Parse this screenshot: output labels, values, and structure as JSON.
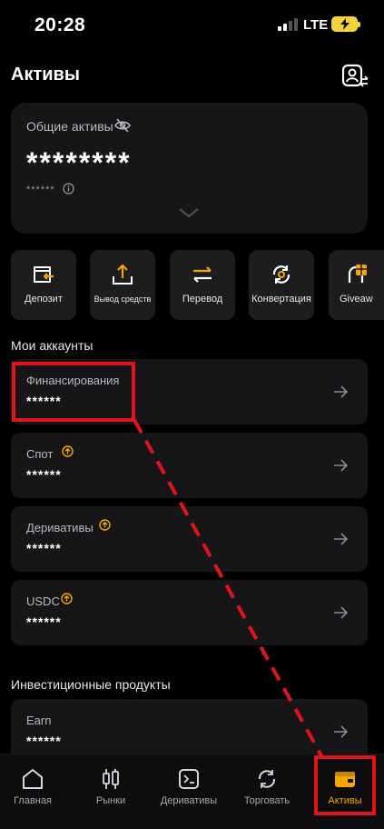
{
  "status": {
    "time": "20:28",
    "network": "LTE"
  },
  "header": {
    "title": "Активы"
  },
  "total": {
    "label": "Общие активы",
    "value": "********",
    "sub": "******"
  },
  "actions": [
    {
      "label": "Депозит",
      "icon": "deposit-icon"
    },
    {
      "label": "Вывод средств",
      "icon": "withdraw-icon"
    },
    {
      "label": "Перевод",
      "icon": "transfer-icon"
    },
    {
      "label": "Конвертация",
      "icon": "convert-icon"
    },
    {
      "label": "Giveaw",
      "icon": "giveaway-icon"
    }
  ],
  "accounts": {
    "title": "Мои аккаунты",
    "items": [
      {
        "name": "Финансирования",
        "value": "******"
      },
      {
        "name": "Спот",
        "value": "******"
      },
      {
        "name": "Деривативы",
        "value": "******"
      },
      {
        "name": "USDC",
        "value": "******"
      }
    ]
  },
  "investments": {
    "title": "Инвестиционные продукты",
    "items": [
      {
        "name": "Earn",
        "value": "******"
      }
    ]
  },
  "nav": [
    {
      "label": "Главная",
      "icon": "home-icon"
    },
    {
      "label": "Рынки",
      "icon": "markets-icon"
    },
    {
      "label": "Деривативы",
      "icon": "derivatives-icon"
    },
    {
      "label": "Торговать",
      "icon": "trade-icon"
    },
    {
      "label": "Активы",
      "icon": "wallet-icon"
    }
  ],
  "colors": {
    "accent": "#f7a600",
    "annotation": "#e0141b",
    "card": "#161618"
  }
}
